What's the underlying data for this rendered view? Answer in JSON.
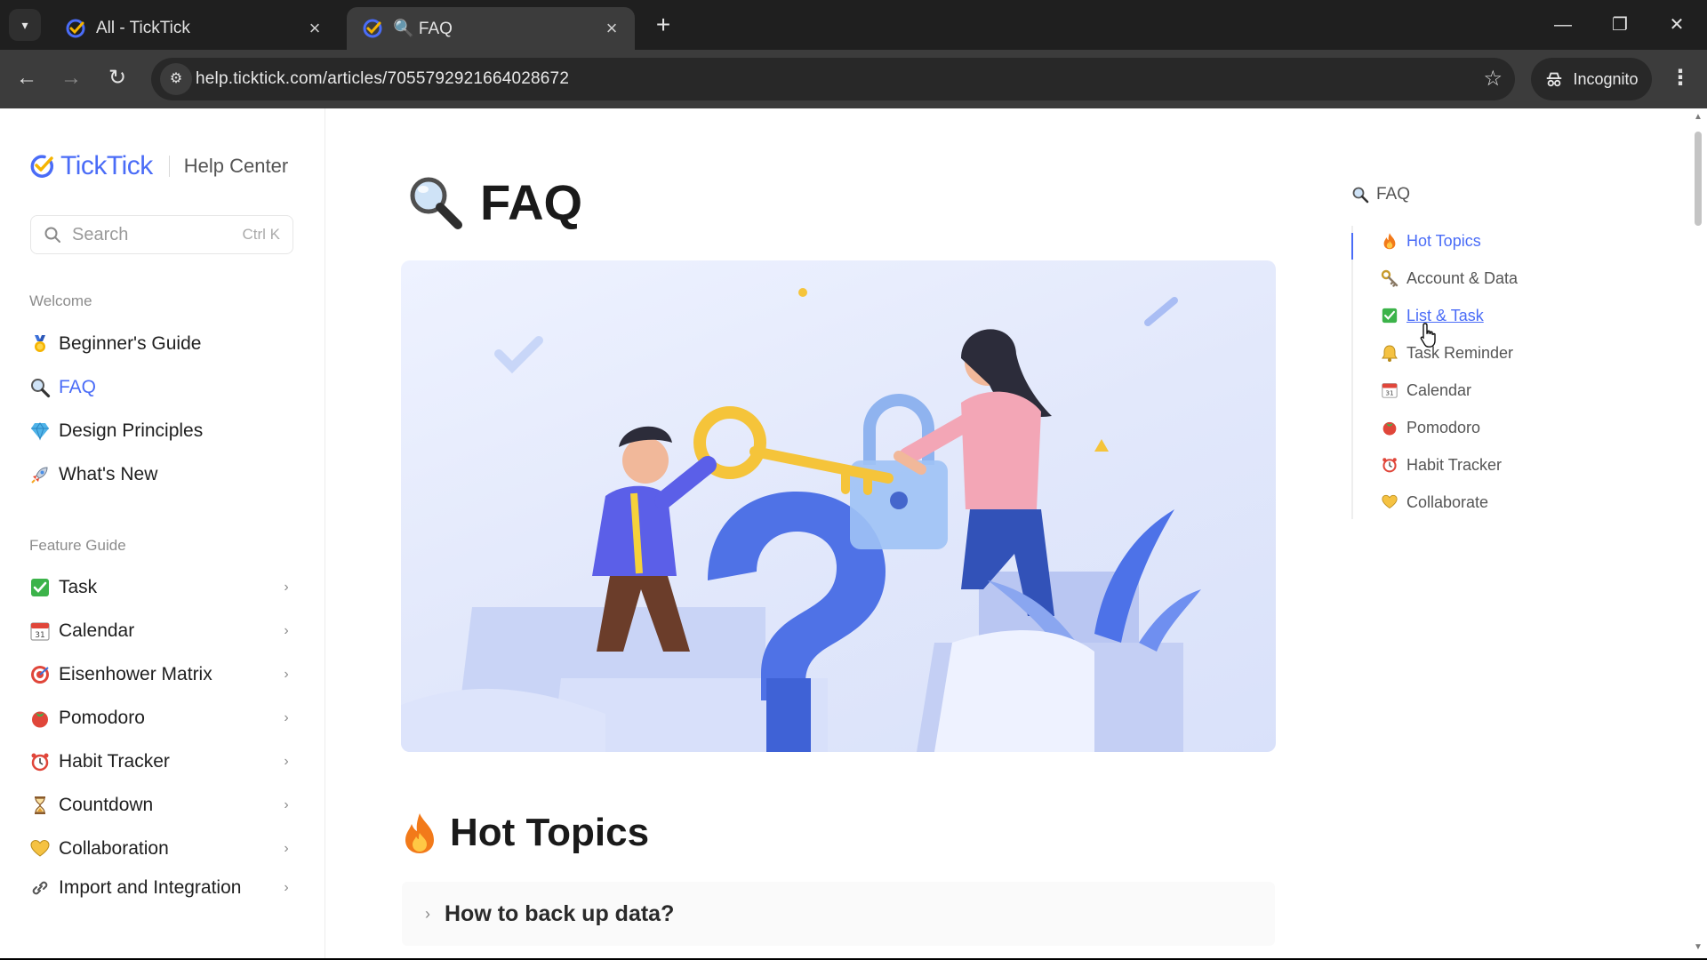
{
  "browser": {
    "tabs": [
      {
        "title": "All - TickTick",
        "active": false
      },
      {
        "title": "🔍 FAQ",
        "active": true
      }
    ],
    "new_tab_label": "+",
    "url": "help.ticktick.com/articles/7055792921664028672",
    "incognito_label": "Incognito"
  },
  "sidebar": {
    "brand": "TickTick",
    "help_center": "Help Center",
    "search": {
      "placeholder": "Search",
      "shortcut": "Ctrl K"
    },
    "welcome_label": "Welcome",
    "welcome_items": [
      {
        "label": "Beginner's Guide",
        "icon": "medal-icon"
      },
      {
        "label": "FAQ",
        "icon": "magnifier-icon",
        "active": true
      },
      {
        "label": "Design Principles",
        "icon": "gem-icon"
      },
      {
        "label": "What's New",
        "icon": "rocket-icon"
      }
    ],
    "feature_label": "Feature Guide",
    "feature_items": [
      {
        "label": "Task",
        "icon": "check-box-icon"
      },
      {
        "label": "Calendar",
        "icon": "calendar-icon"
      },
      {
        "label": "Eisenhower Matrix",
        "icon": "target-icon"
      },
      {
        "label": "Pomodoro",
        "icon": "tomato-icon"
      },
      {
        "label": "Habit Tracker",
        "icon": "alarm-clock-icon"
      },
      {
        "label": "Countdown",
        "icon": "hourglass-icon"
      },
      {
        "label": "Collaboration",
        "icon": "heart-icon"
      },
      {
        "label": "Import and Integration",
        "icon": "link-icon"
      }
    ]
  },
  "main": {
    "title": "FAQ",
    "section_title": "Hot Topics",
    "faq_question": "How to back up data?"
  },
  "toc": {
    "head": "FAQ",
    "items": [
      {
        "label": "Hot Topics",
        "icon": "fire-icon",
        "state": "active"
      },
      {
        "label": "Account & Data",
        "icon": "key-icon"
      },
      {
        "label": "List & Task",
        "icon": "check-box-icon",
        "state": "hover"
      },
      {
        "label": "Task Reminder",
        "icon": "bell-icon"
      },
      {
        "label": "Calendar",
        "icon": "calendar-icon"
      },
      {
        "label": "Pomodoro",
        "icon": "tomato-icon"
      },
      {
        "label": "Habit Tracker",
        "icon": "alarm-clock-icon"
      },
      {
        "label": "Collaborate",
        "icon": "heart-icon"
      }
    ]
  },
  "colors": {
    "accent": "#4a6cf7",
    "chrome_dark": "#1f1f1f",
    "chrome_toolbar": "#3c3c3c"
  }
}
